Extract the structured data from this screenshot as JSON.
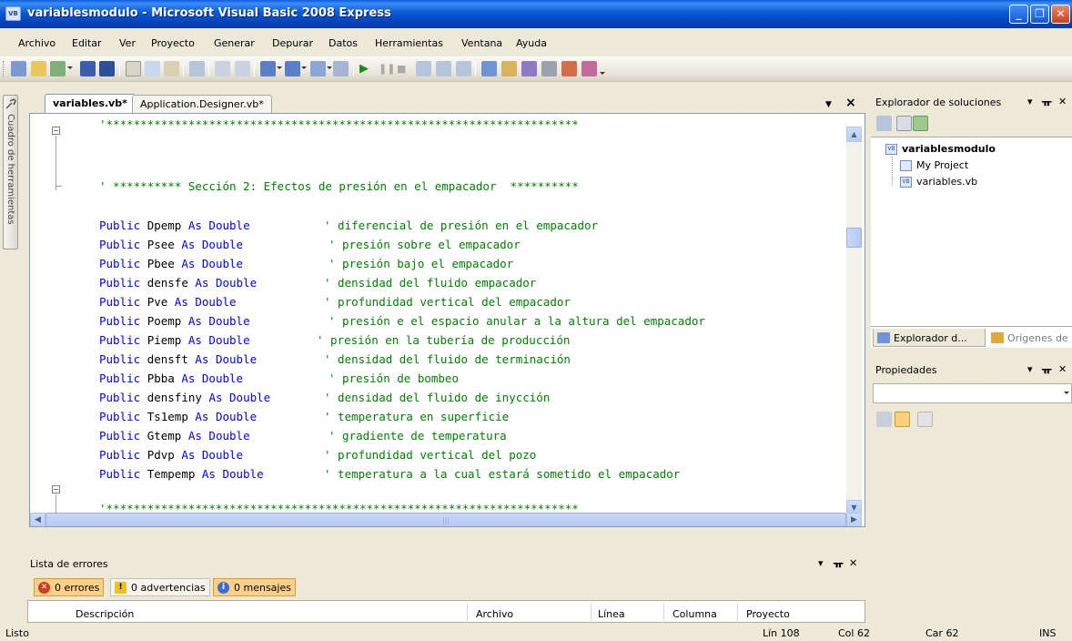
{
  "window": {
    "title": "variablesmodulo - Microsoft Visual Basic 2008 Express",
    "app_icon_text": "VB"
  },
  "menu": [
    "Archivo",
    "Editar",
    "Ver",
    "Proyecto",
    "Generar",
    "Depurar",
    "Datos",
    "Herramientas",
    "Ventana",
    "Ayuda"
  ],
  "toolbox": {
    "label": "Cuadro de herramientas"
  },
  "document_tabs": [
    {
      "label": "variables.vb*",
      "active": true
    },
    {
      "label": "Application.Designer.vb*",
      "active": false
    }
  ],
  "code": {
    "separator_top": "'*********************************************************************",
    "section_comment": "' ********** Sección 2: Efectos de presión en el empacador  **********",
    "declarations": [
      {
        "kw1": "Public",
        "name": "Dpemp",
        "kw2": "As Double",
        "comment": "' diferencial de presión en el empacador"
      },
      {
        "kw1": "Public",
        "name": "Psee",
        "kw2": "As Double",
        "comment": "' presión sobre el empacador"
      },
      {
        "kw1": "Public",
        "name": "Pbee",
        "kw2": "As Double",
        "comment": "' presión bajo el empacador"
      },
      {
        "kw1": "Public",
        "name": "densfe",
        "kw2": "As Double",
        "comment": "' densidad del fluido empacador"
      },
      {
        "kw1": "Public",
        "name": "Pve",
        "kw2": "As Double",
        "comment": "' profundidad vertical del empacador"
      },
      {
        "kw1": "Public",
        "name": "Poemp",
        "kw2": "As Double",
        "comment": "' presión e el espacio anular a la altura del empacador"
      },
      {
        "kw1": "Public",
        "name": "Piemp",
        "kw2": "As Double",
        "comment": "' presión en la tubería de producción"
      },
      {
        "kw1": "Public",
        "name": "densft",
        "kw2": "As Double",
        "comment": "' densidad del fluido de terminación"
      },
      {
        "kw1": "Public",
        "name": "Pbba",
        "kw2": "As Double",
        "comment": "' presión de bombeo"
      },
      {
        "kw1": "Public",
        "name": "densfiny",
        "kw2": "As Double",
        "comment": "' densidad del fluido de inycción"
      },
      {
        "kw1": "Public",
        "name": "Ts1emp",
        "kw2": "As Double",
        "comment": "' temperatura en superficie"
      },
      {
        "kw1": "Public",
        "name": "Gtemp",
        "kw2": "As Double",
        "comment": "' gradiente de temperatura"
      },
      {
        "kw1": "Public",
        "name": "Pdvp",
        "kw2": "As Double",
        "comment": "' profundidad vertical del pozo"
      },
      {
        "kw1": "Public",
        "name": "Tempemp",
        "kw2": "As Double",
        "comment": "' temperatura a la cual estará sometido el empacador"
      }
    ],
    "separator_bottom": "'*********************************************************************"
  },
  "error_list": {
    "title": "Lista de errores",
    "filters": {
      "errors": "0 errores",
      "warnings": "0 advertencias",
      "messages": "0 mensajes"
    },
    "columns": [
      "Descripción",
      "Archivo",
      "Línea",
      "Columna",
      "Proyecto"
    ]
  },
  "solution_explorer": {
    "title": "Explorador de soluciones",
    "project": "variablesmodulo",
    "items": [
      "My Project",
      "variables.vb"
    ],
    "tabs": [
      "Explorador d...",
      "Orígenes de ..."
    ]
  },
  "properties": {
    "title": "Propiedades"
  },
  "status": {
    "message": "Listo",
    "line": "Lín 108",
    "col": "Col 62",
    "car": "Car 62",
    "mode": "INS"
  },
  "colors": {
    "keyword": "#0000ff",
    "comment": "#008000",
    "titlebar": "#0b5ad3",
    "chrome": "#ece9d8"
  }
}
